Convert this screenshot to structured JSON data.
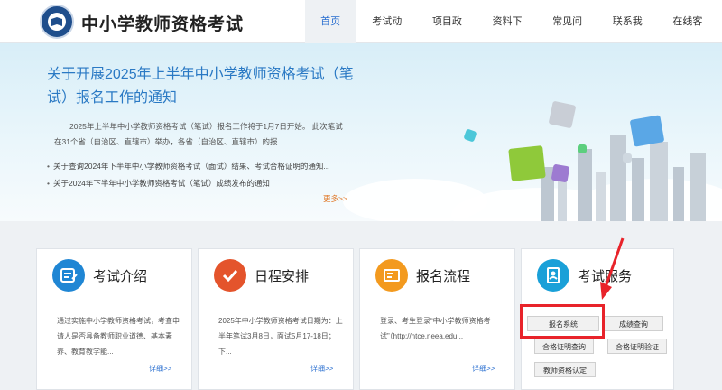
{
  "header": {
    "title": "中小学教师资格考试",
    "nav": [
      "首页",
      "考试动态",
      "项目政策",
      "资料下载",
      "常见问题",
      "联系我们",
      "在线客服"
    ]
  },
  "banner": {
    "headline": "关于开展2025年上半年中小学教师资格考试（笔试）报名工作的通知",
    "summary": "2025年上半年中小学教师资格考试（笔试）报名工作将于1月7日开始。  此次笔试在31个省（自治区、直辖市）举办，各省（自治区、直辖市）的报...",
    "links": [
      "关于查询2024年下半年中小学教师资格考试（面试）结果、考试合格证明的通知...",
      "关于2024年下半年中小学教师资格考试（笔试）成绩发布的通知"
    ],
    "more": "更多>>"
  },
  "cards": [
    {
      "title": "考试介绍",
      "text": "通过实施中小学教师资格考试，考查申请人是否具备教师职业道德、基本素养、教育教学能...",
      "more": "详细>>",
      "icon": "id-card-icon",
      "color": "#1f86d4"
    },
    {
      "title": "日程安排",
      "text": "2025年中小学教师资格考试日期为：上半年笔试3月8日，面试5月17-18日；下...",
      "more": "详细>>",
      "icon": "check-icon",
      "color": "#e4542c"
    },
    {
      "title": "报名流程",
      "text": "登录、考生登录“中小学教师资格考试”（http://ntce.neea.edu...",
      "more": "详细>>",
      "icon": "form-icon",
      "color": "#f39a1f"
    }
  ],
  "service": {
    "title": "考试服务",
    "icon": "contacts-book-icon",
    "color": "#1aa0d8",
    "buttons": [
      "报名系统",
      "成绩查询",
      "合格证明查询",
      "合格证明验证",
      "教师资格认定"
    ]
  }
}
